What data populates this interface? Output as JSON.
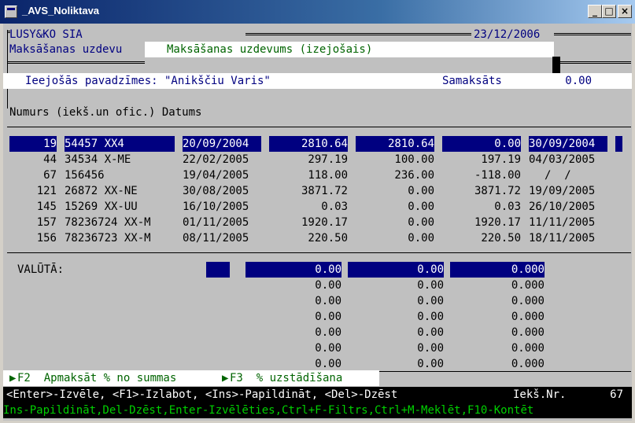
{
  "window": {
    "title": "_AVS_Noliktava"
  },
  "header": {
    "company": "LUSY&KO SIA",
    "date": "23/12/2006",
    "section_label": "Maksāšanas uzdevu"
  },
  "doc_title": "Maksāšanas uzdevums (izejošais)",
  "invoice": {
    "label": "Ieejošās pavadzīmes: \"Anikščiu Varis\"",
    "paid_label": "Samaksāts",
    "paid_value": "0.00"
  },
  "columns": {
    "header": "Numurs (iekš.un ofic.) Datums"
  },
  "rows": [
    {
      "no": "19",
      "ref": "54457 XX4",
      "date": "20/09/2004",
      "amount": "2810.64",
      "paid": "2810.64",
      "rest": "0.00",
      "due": "30/09/2004"
    },
    {
      "no": "44",
      "ref": "34534 X-ME",
      "date": "22/02/2005",
      "amount": "297.19",
      "paid": "100.00",
      "rest": "197.19",
      "due": "04/03/2005"
    },
    {
      "no": "67",
      "ref": "156456",
      "date": "19/04/2005",
      "amount": "118.00",
      "paid": "236.00",
      "rest": "-118.00",
      "due": "/  /"
    },
    {
      "no": "121",
      "ref": "26872 XX-NE",
      "date": "30/08/2005",
      "amount": "3871.72",
      "paid": "0.00",
      "rest": "3871.72",
      "due": "19/09/2005"
    },
    {
      "no": "145",
      "ref": "15269 XX-UU",
      "date": "16/10/2005",
      "amount": "0.03",
      "paid": "0.00",
      "rest": "0.03",
      "due": "26/10/2005"
    },
    {
      "no": "157",
      "ref": "78236724 XX-M",
      "date": "01/11/2005",
      "amount": "1920.17",
      "paid": "0.00",
      "rest": "1920.17",
      "due": "11/11/2005"
    },
    {
      "no": "156",
      "ref": "78236723 XX-M",
      "date": "08/11/2005",
      "amount": "220.50",
      "paid": "0.00",
      "rest": "220.50",
      "due": "18/11/2005"
    }
  ],
  "currency": {
    "label": "VALŪTĀ:",
    "rows": [
      [
        "0.00",
        "0.00",
        "0.000"
      ],
      [
        "0.00",
        "0.00",
        "0.000"
      ],
      [
        "0.00",
        "0.00",
        "0.000"
      ],
      [
        "0.00",
        "0.00",
        "0.000"
      ],
      [
        "0.00",
        "0.00",
        "0.000"
      ],
      [
        "0.00",
        "0.00",
        "0.000"
      ],
      [
        "0.00",
        "0.00",
        "0.000"
      ]
    ]
  },
  "fkeys": {
    "f2": "F2  Apmaksāt % no summas",
    "f3": "F3  % uzstādīšana"
  },
  "status": {
    "keys": "<Enter>-Izvēle, <F1>-Izlabot, <Ins>-Papildināt, <Del>-Dzēst",
    "counter_label": "Iekš.Nr.",
    "counter_value": "67"
  },
  "hint": "Ins-Papildināt,Del-Dzēst,Enter-Izvēlēties,Ctrl+F-Filtrs,Ctrl+M-Meklēt,F10-Kontēt",
  "colors": {
    "selection": "#000080",
    "terminal_bg": "#c0c0c0",
    "hint_text": "#006400"
  }
}
